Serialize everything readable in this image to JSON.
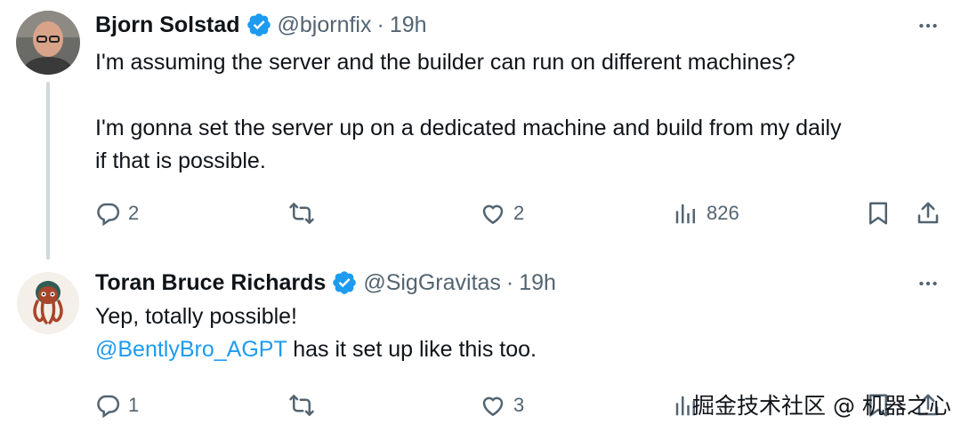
{
  "tweets": [
    {
      "author": "Bjorn Solstad",
      "handle": "@bjornfix",
      "separator": "·",
      "time": "19h",
      "lines": [
        "I'm assuming the server and the builder can run on different machines?"
      ],
      "lines2": [
        "I'm gonna set the server up on a dedicated machine and build from my daily",
        "if that is possible."
      ],
      "replies": "2",
      "reposts": "",
      "likes": "2",
      "views": "826"
    },
    {
      "author": "Toran Bruce Richards",
      "handle": "@SigGravitas",
      "separator": "·",
      "time": "19h",
      "line1": "Yep, totally possible!",
      "mention": "@BentlyBro_AGPT",
      "line2_rest": " has it set up like this too.",
      "replies": "1",
      "reposts": "",
      "likes": "3"
    }
  ],
  "watermark": "掘金技术社区 @ 机器之心",
  "colors": {
    "text": "#0f1419",
    "secondary": "#536471",
    "accent": "#1d9bf0",
    "thread_line": "#cfd9de"
  },
  "icons": [
    "verified-badge-icon",
    "more-icon",
    "reply-icon",
    "repost-icon",
    "like-icon",
    "views-icon",
    "bookmark-icon",
    "share-icon"
  ]
}
